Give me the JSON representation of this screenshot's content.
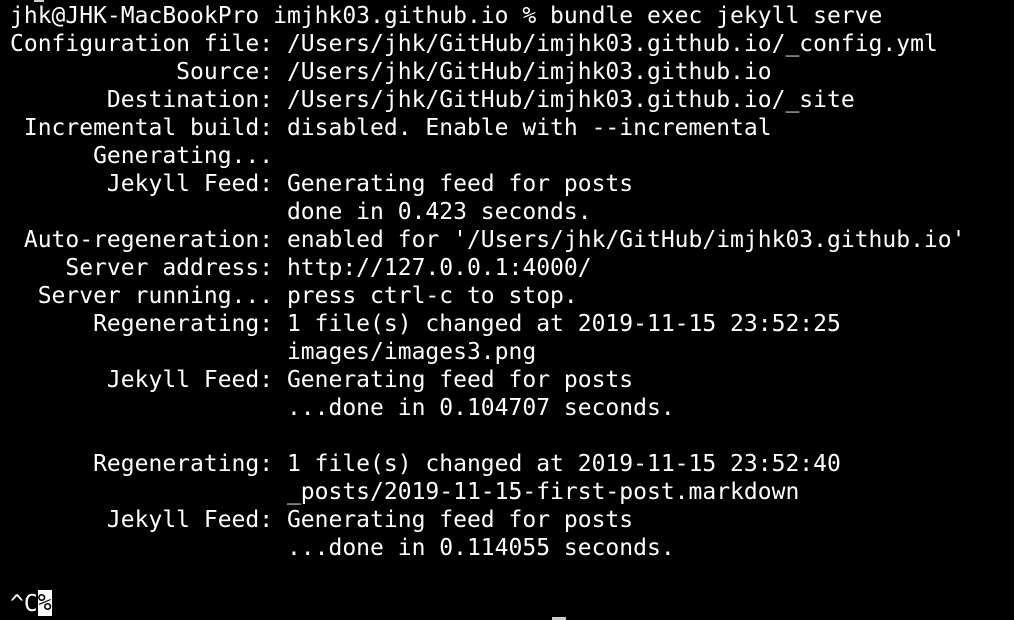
{
  "terminal": {
    "lines": [
      "jhk@JHK-MacBookPro imjhk03.github.io % bundle exec jekyll serve",
      "Configuration file: /Users/jhk/GitHub/imjhk03.github.io/_config.yml",
      "            Source: /Users/jhk/GitHub/imjhk03.github.io",
      "       Destination: /Users/jhk/GitHub/imjhk03.github.io/_site",
      " Incremental build: disabled. Enable with --incremental",
      "      Generating...",
      "       Jekyll Feed: Generating feed for posts",
      "                    done in 0.423 seconds.",
      " Auto-regeneration: enabled for '/Users/jhk/GitHub/imjhk03.github.io'",
      "    Server address: http://127.0.0.1:4000/",
      "  Server running... press ctrl-c to stop.",
      "      Regenerating: 1 file(s) changed at 2019-11-15 23:52:25",
      "                    images/images3.png",
      "       Jekyll Feed: Generating feed for posts",
      "                    ...done in 0.104707 seconds.",
      "",
      "      Regenerating: 1 file(s) changed at 2019-11-15 23:52:40",
      "                    _posts/2019-11-15-first-post.markdown",
      "       Jekyll Feed: Generating feed for posts",
      "                    ...done in 0.114055 seconds.",
      "",
      ""
    ],
    "final_prompt_text": "^C",
    "cursor_glyph": "%",
    "colors": {
      "background": "#000000",
      "foreground": "#ffffff"
    }
  }
}
